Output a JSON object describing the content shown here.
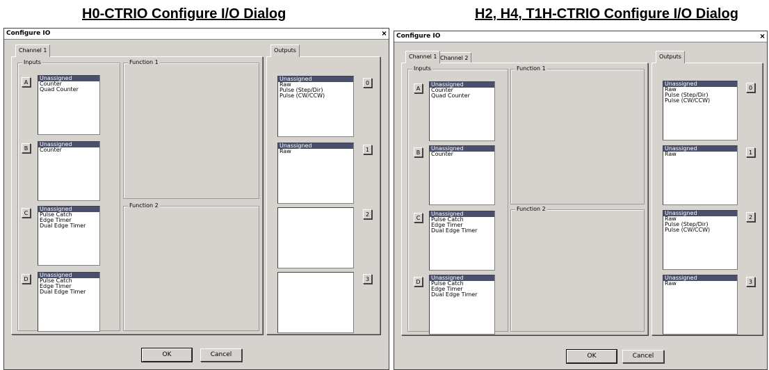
{
  "left": {
    "heading": "H0-CTRIO Configure I/O Dialog",
    "dialog_title": "Configure IO",
    "close_glyph": "×",
    "tabs": [
      "Channel 1"
    ],
    "inputs_label": "Inputs",
    "function1_label": "Function 1",
    "function2_label": "Function 2",
    "outputs_tab": "Outputs",
    "inputs": [
      {
        "button": "A",
        "items": [
          "Unassigned",
          "Counter",
          "Quad Counter"
        ]
      },
      {
        "button": "B",
        "items": [
          "Unassigned",
          "Counter"
        ]
      },
      {
        "button": "C",
        "items": [
          "Unassigned",
          "Pulse Catch",
          "Edge Timer",
          "Dual Edge Timer"
        ]
      },
      {
        "button": "D",
        "items": [
          "Unassigned",
          "Pulse Catch",
          "Edge Timer",
          "Dual Edge Timer"
        ]
      }
    ],
    "outputs": [
      {
        "button": "0",
        "items": [
          "Unassigned",
          "Raw",
          "Pulse (Step/Dir)",
          "Pulse (CW/CCW)"
        ]
      },
      {
        "button": "1",
        "items": [
          "Unassigned",
          "Raw"
        ]
      },
      {
        "button": "2",
        "items": []
      },
      {
        "button": "3",
        "items": []
      }
    ],
    "ok": "OK",
    "cancel": "Cancel"
  },
  "right": {
    "heading": "H2, H4, T1H-CTRIO Configure I/O Dialog",
    "dialog_title": "Configure IO",
    "close_glyph": "×",
    "tabs": [
      "Channel 1",
      "Channel 2"
    ],
    "inputs_label": "Inputs",
    "function1_label": "Function 1",
    "function2_label": "Function 2",
    "outputs_tab": "Outputs",
    "inputs": [
      {
        "button": "A",
        "items": [
          "Unassigned",
          "Counter",
          "Quad Counter"
        ]
      },
      {
        "button": "B",
        "items": [
          "Unassigned",
          "Counter"
        ]
      },
      {
        "button": "C",
        "items": [
          "Unassigned",
          "Pulse Catch",
          "Edge Timer",
          "Dual Edge Timer"
        ]
      },
      {
        "button": "D",
        "items": [
          "Unassigned",
          "Pulse Catch",
          "Edge Timer",
          "Dual Edge Timer"
        ]
      }
    ],
    "outputs": [
      {
        "button": "0",
        "items": [
          "Unassigned",
          "Raw",
          "Pulse (Step/Dir)",
          "Pulse (CW/CCW)"
        ]
      },
      {
        "button": "1",
        "items": [
          "Unassigned",
          "Raw"
        ]
      },
      {
        "button": "2",
        "items": [
          "Unassigned",
          "Raw",
          "Pulse (Step/Dir)",
          "Pulse (CW/CCW)"
        ]
      },
      {
        "button": "3",
        "items": [
          "Unassigned",
          "Raw"
        ]
      }
    ],
    "ok": "OK",
    "cancel": "Cancel"
  }
}
